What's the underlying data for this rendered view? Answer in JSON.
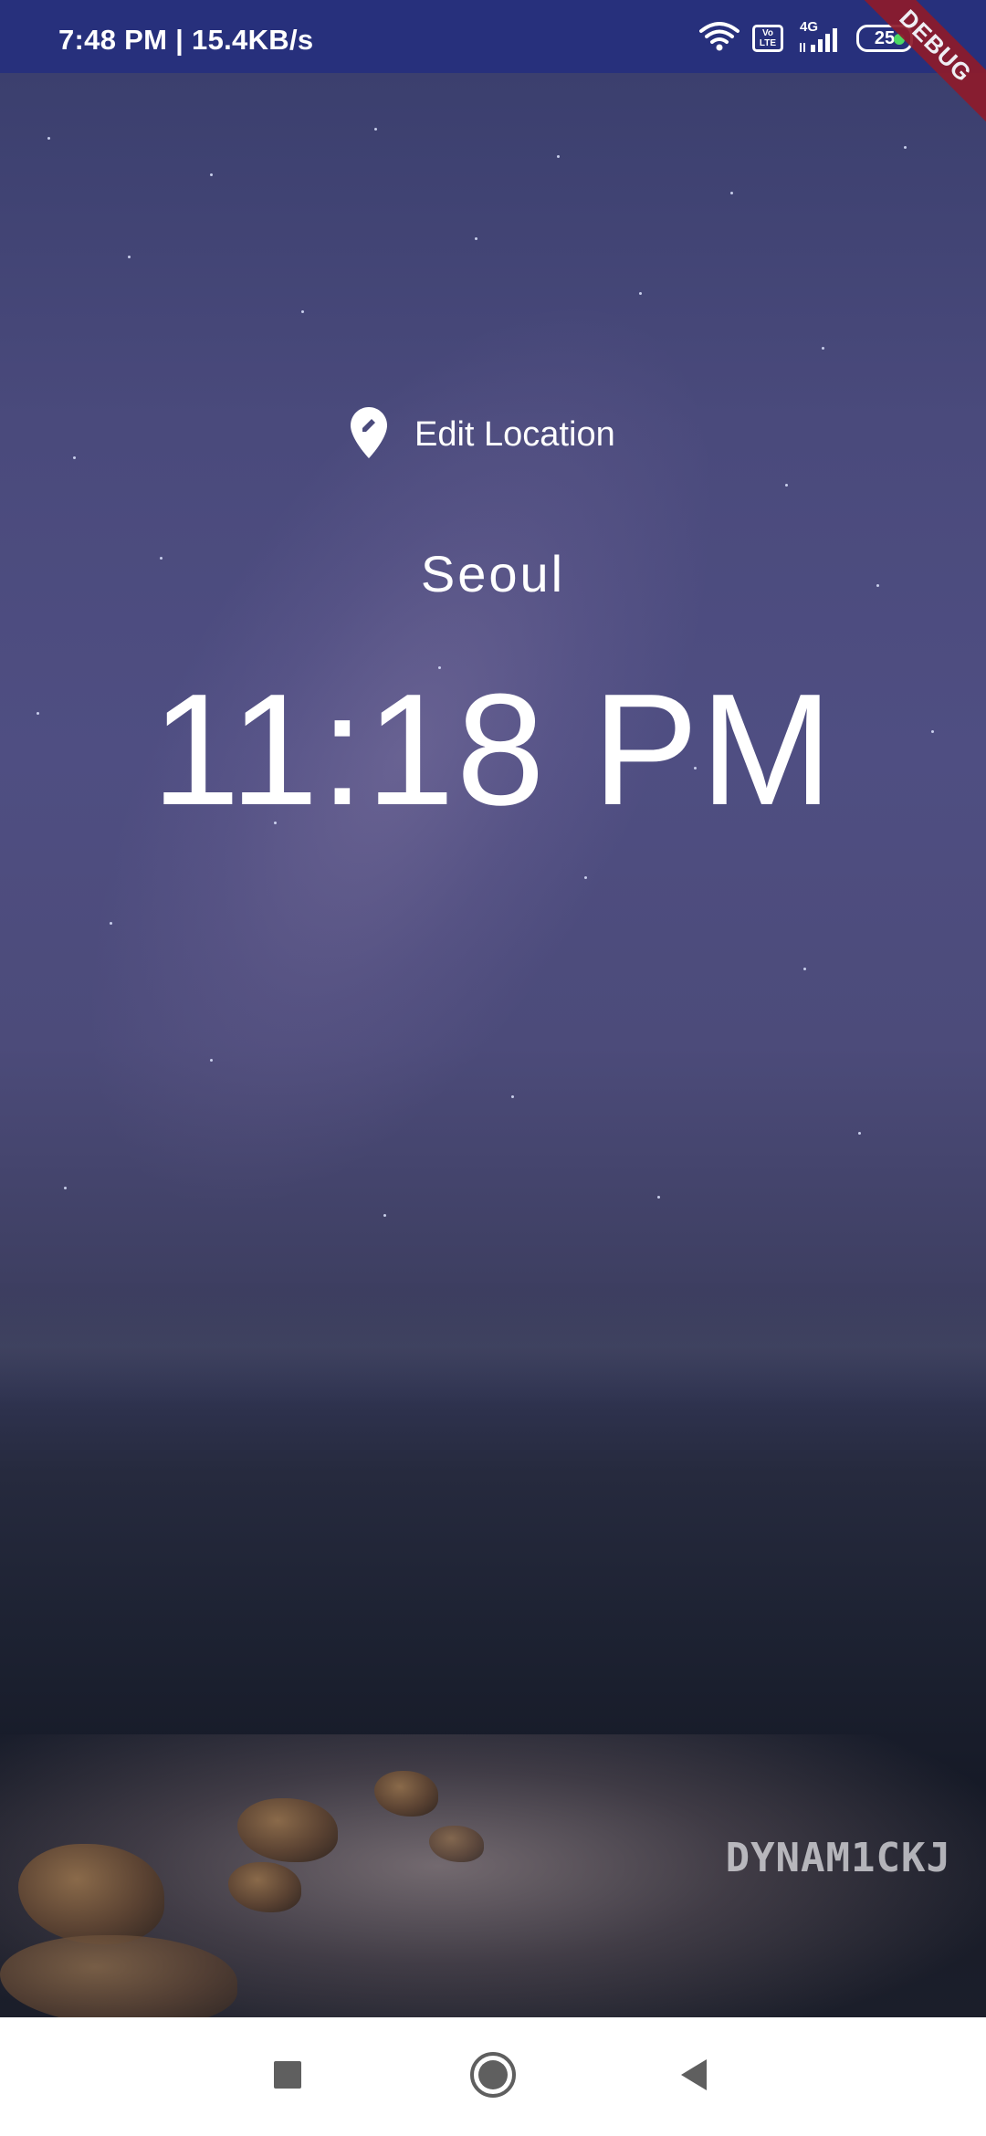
{
  "status_bar": {
    "time": "7:48 PM | 15.4KB/s",
    "volte_label": "Vo LTE",
    "network_label": "4G",
    "battery_level": "25",
    "debug_label": "DEBUG"
  },
  "location": {
    "edit_label": "Edit Location",
    "city": "Seoul",
    "time": "11:18 PM"
  },
  "watermark": "DYNAM1CKJ",
  "colors": {
    "status_bar": "#27307c",
    "debug_ribbon": "#8e1b2b",
    "nav_bar": "#ffffff",
    "nav_icon": "#5f5f5f",
    "text": "#ffffff"
  },
  "icons": {
    "edit_location": "edit-location-pin-icon",
    "wifi": "wifi-icon",
    "signal": "cell-signal-icon",
    "recents": "square-recents-icon",
    "home": "circle-home-icon",
    "back": "triangle-back-icon"
  }
}
